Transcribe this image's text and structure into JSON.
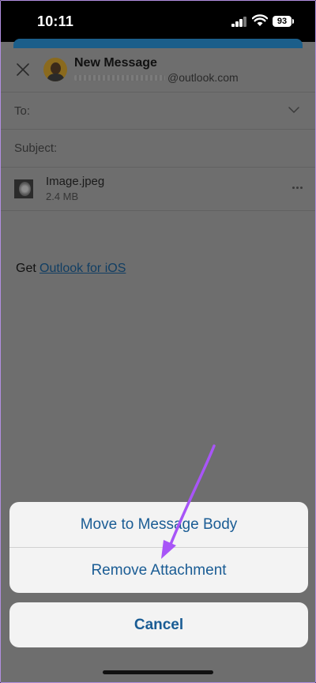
{
  "status_bar": {
    "time": "10:11",
    "battery": "93",
    "icons": [
      "signal-icon",
      "wifi-icon",
      "battery-icon"
    ]
  },
  "compose": {
    "title": "New Message",
    "sender_domain": "@outlook.com",
    "to_label": "To:",
    "subject_label": "Subject:",
    "attachment": {
      "name": "Image.jpeg",
      "size": "2.4 MB"
    },
    "signature_prefix": "Get",
    "signature_link": "Outlook for iOS",
    "icons": [
      "close-icon",
      "avatar",
      "chevron-down-icon",
      "more-icon"
    ]
  },
  "action_sheet": {
    "items": [
      "Move to Message Body",
      "Remove Attachment"
    ],
    "cancel": "Cancel"
  },
  "colors": {
    "accent": "#1a5c94",
    "annotation_arrow": "#a855f7",
    "sheet_background": "#f3f3f3"
  }
}
